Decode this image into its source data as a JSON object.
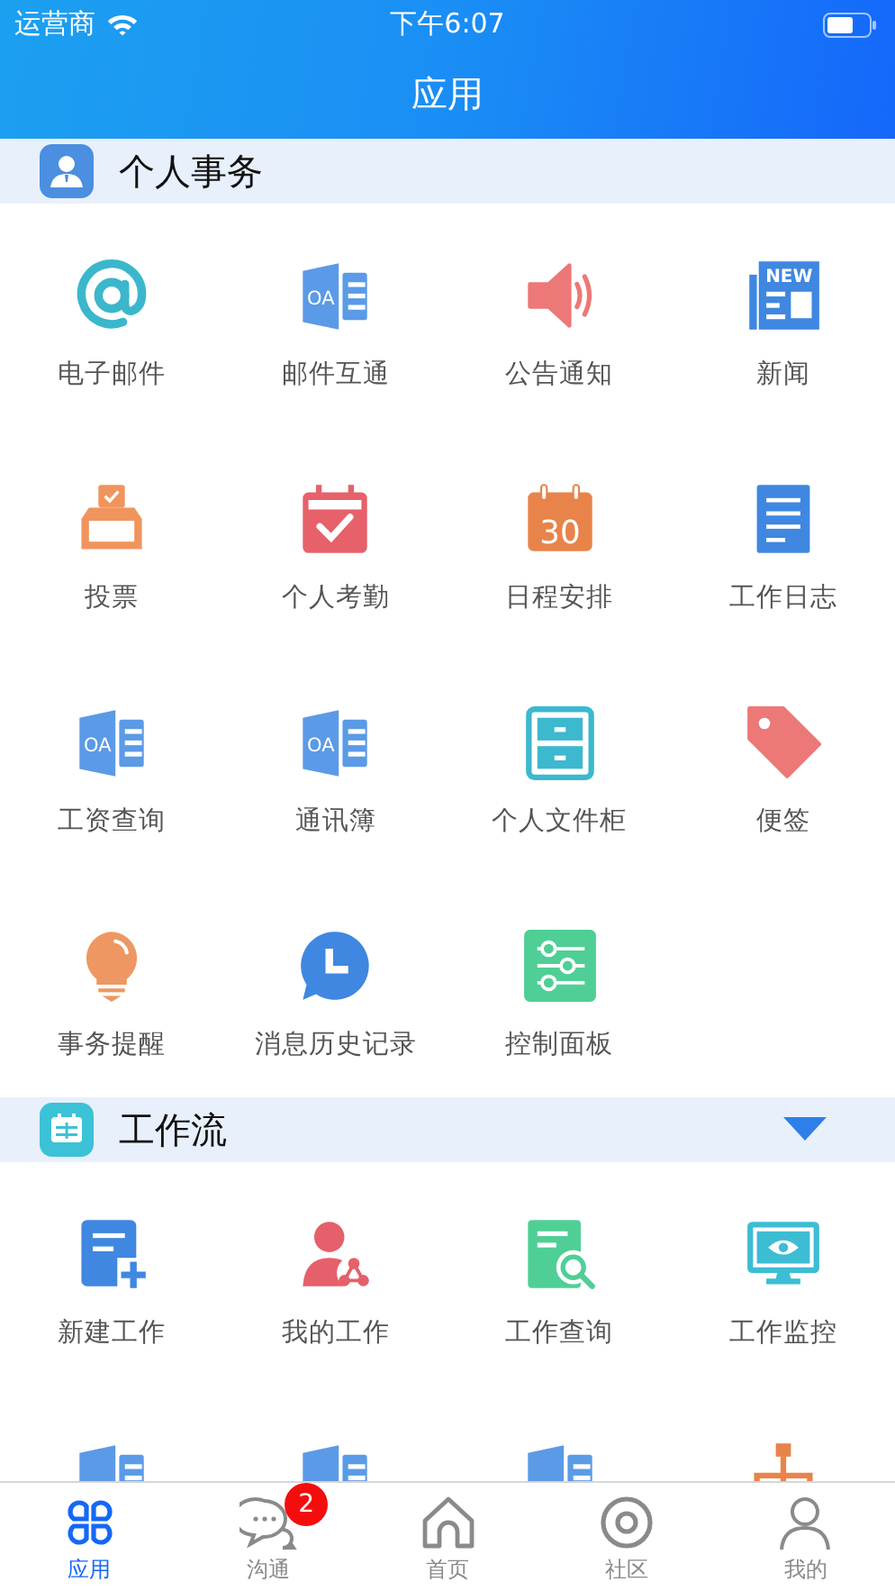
{
  "status_bar": {
    "carrier": "运营商",
    "time": "下午6:07"
  },
  "nav_bar": {
    "title": "应用"
  },
  "sections": [
    {
      "title": "个人事务",
      "kind": "person",
      "items": [
        {
          "label": "电子邮件",
          "kind": "email"
        },
        {
          "label": "邮件互通",
          "kind": "oa",
          "icon_text": "OA"
        },
        {
          "label": "公告通知",
          "kind": "speaker"
        },
        {
          "label": "新闻",
          "kind": "news",
          "icon_text": "NEW"
        },
        {
          "label": "投票",
          "kind": "ballot"
        },
        {
          "label": "个人考勤",
          "kind": "attendance"
        },
        {
          "label": "日程安排",
          "kind": "calendar",
          "icon_text": "30"
        },
        {
          "label": "工作日志",
          "kind": "notes"
        },
        {
          "label": "工资查询",
          "kind": "oa",
          "icon_text": "OA"
        },
        {
          "label": "通讯簿",
          "kind": "oa",
          "icon_text": "OA"
        },
        {
          "label": "个人文件柜",
          "kind": "cabinet"
        },
        {
          "label": "便签",
          "kind": "tag"
        },
        {
          "label": "事务提醒",
          "kind": "bulb"
        },
        {
          "label": "消息历史记录",
          "kind": "clock"
        },
        {
          "label": "控制面板",
          "kind": "sliders"
        }
      ]
    },
    {
      "title": "工作流",
      "kind": "calendar",
      "expanded": true,
      "items": [
        {
          "label": "新建工作",
          "kind": "newdoc"
        },
        {
          "label": "我的工作",
          "kind": "usershare"
        },
        {
          "label": "工作查询",
          "kind": "docsearch"
        },
        {
          "label": "工作监控",
          "kind": "monitor"
        },
        {
          "kind": "oa"
        },
        {
          "kind": "oa"
        },
        {
          "kind": "oa"
        },
        {
          "kind": "orgchart"
        }
      ]
    }
  ],
  "tab_bar": [
    {
      "label": "应用",
      "kind": "apps",
      "selected": true
    },
    {
      "label": "沟通",
      "kind": "chat",
      "selected": false,
      "badge": "2"
    },
    {
      "label": "首页",
      "kind": "home",
      "selected": false
    },
    {
      "label": "社区",
      "kind": "ring",
      "selected": false
    },
    {
      "label": "我的",
      "kind": "user",
      "selected": false
    }
  ]
}
